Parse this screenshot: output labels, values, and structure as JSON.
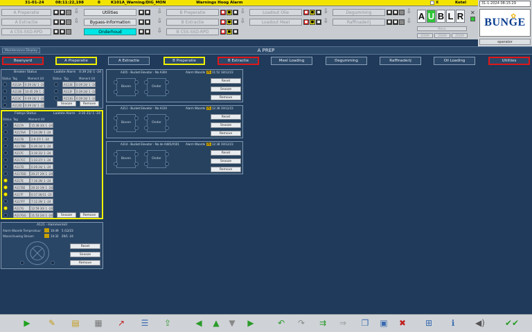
{
  "alarm_bar": {
    "date": "31-01-24",
    "time": "08:11:22,198",
    "count": "0",
    "tag": "K101A_Warning/DIG_MON",
    "message": "Warnings Hoog Alarm",
    "ack_mark": "X",
    "area": "Ketel"
  },
  "header": {
    "left_col": [
      "A Preperatie",
      "A Extractie",
      "A CSS-SSD-RPD"
    ],
    "mid_col": [
      "Utilities",
      "Bypass-Information",
      "Onderhoud"
    ],
    "right_col": [
      "B Preperatie",
      "B Extractie",
      "B CSS-SSD-RPD"
    ],
    "loadout_col": [
      "Loadout Olie",
      "Loadout Meel"
    ],
    "far_col": [
      "Degumming",
      "Raffinaderij"
    ],
    "aublr": [
      "A",
      "U",
      "B",
      "L",
      "R"
    ],
    "mini_top": "Mimic",
    "mini_btns": [
      "ZOOM",
      "ZOOM",
      "ZOOM"
    ]
  },
  "right_panel": {
    "datetime": "31-1-2024 08:15:29",
    "brand": "BUNGE",
    "operator": "operator"
  },
  "title": {
    "display_tab": "Maintenance Display",
    "page_title": "A PREP"
  },
  "nav": {
    "tabs": [
      "Beanyard",
      "A Preperatie",
      "A Extractie",
      "B Preperatie",
      "B Extractie",
      "Meel Loading",
      "Degumming",
      "Raffinaderij",
      "Oil Loading",
      "Utilities"
    ]
  },
  "breaker": {
    "title": "Breaker Status",
    "last_alarm_label": "Laatste Alarm",
    "last_alarm": "0:39 24/ 1 -24",
    "cols": [
      "Status",
      "Tag",
      "Moment Uit"
    ],
    "left_rows": [
      {
        "tag": "A113A",
        "moment": "0:39 24/ 1 -24"
      },
      {
        "tag": "A113B",
        "moment": "10:45 29/ 1 -24"
      },
      {
        "tag": "A113C",
        "moment": "0:39 24/ 1 -24"
      },
      {
        "tag": "A113D",
        "moment": "0:39 24/ 1 -24"
      }
    ],
    "right_rows": [
      {
        "tag": "A113E",
        "moment": "0:39 24/ 1 -24"
      },
      {
        "tag": "A113F",
        "moment": "0:39 24/ 1 -24"
      },
      {
        "tag": "A113G",
        "moment": "0:39 24/ 1 -24"
      }
    ],
    "snooze": "Snooze",
    "remove": "Remove"
  },
  "flatsys": {
    "title": "Flatsys Status",
    "last_alarm_label": "Laatste Alarm",
    "last_alarm": "3:16 31/ 1 -24",
    "cols": [
      "Status",
      "Tag",
      "Moment Uit"
    ],
    "rows": [
      {
        "tag": "A117A",
        "moment": "15:38 30/ 1 -24",
        "on": false
      },
      {
        "tag": "A117AA",
        "moment": "7:24 29/ 1 -24",
        "on": false
      },
      {
        "tag": "A117B",
        "moment": "2:9 27/ 1 -24",
        "on": false
      },
      {
        "tag": "A117BB",
        "moment": "0:39 24/ 1 -24",
        "on": false
      },
      {
        "tag": "A117C",
        "moment": "3:10 31/ 1 -24",
        "on": false
      },
      {
        "tag": "A117CC",
        "moment": "1:33 27/ 1 -24",
        "on": false
      },
      {
        "tag": "A117D",
        "moment": "0:39 24/ 1 -24",
        "on": false
      },
      {
        "tag": "A117DD",
        "moment": "20:27 29/ 1 -24",
        "on": false
      },
      {
        "tag": "A117E",
        "moment": "7:16 29/ 1 -24",
        "on": true
      },
      {
        "tag": "A117EE",
        "moment": "20:10 19/ 1 -24",
        "on": true
      },
      {
        "tag": "A117F",
        "moment": "0:17 26/11 -23",
        "on": true
      },
      {
        "tag": "A117FF",
        "moment": "7:12 29/ 1 -24",
        "on": false
      },
      {
        "tag": "A117G",
        "moment": "12:59 30/ 1 -24",
        "on": true
      },
      {
        "tag": "A117GG",
        "moment": "11:53 24/ 1 -24",
        "on": false
      }
    ],
    "snooze": "Snooze",
    "remove": "Remove"
  },
  "hammermill": {
    "title": "A121 - Hammermill",
    "temp_label": "Alarm Waarde Temperatuur",
    "temp_time": "10:49",
    "temp_date": "5 /12/23",
    "water_label": "Waarschuwing Stroom",
    "water_time": "14:32",
    "water_date": "29/1 -24",
    "reset": "Reset",
    "snooze": "Snooze",
    "remove": "Remove"
  },
  "elevators": [
    {
      "title": "A305 - Bucket Elevator - Na A304",
      "alarm_label": "Alarm Waarde",
      "alarm_val": "75",
      "time": "11:52",
      "date": "18/12/23",
      "top": "Boven",
      "bottom": "Onder",
      "reset": "Reset",
      "snooze": "Snooze",
      "remove": "Remove"
    },
    {
      "title": "A311 - Bucket Elevator - Na A310",
      "alarm_label": "Alarm Waarde",
      "alarm_val": "75",
      "time": "12:38",
      "date": "19/12/23",
      "top": "Boven",
      "bottom": "Onder",
      "reset": "Reset",
      "snooze": "Snooze",
      "remove": "Remove"
    },
    {
      "title": "A314 - Bucket Elevator - Na de A485/A501",
      "alarm_label": "Alarm Waarde",
      "alarm_val": "75",
      "time": "12:38",
      "date": "19/12/23",
      "top": "Boven",
      "bottom": "Onder",
      "reset": "Reset",
      "snooze": "Snooze",
      "remove": "Remove"
    }
  ],
  "toolbar_icons": [
    "play-icon",
    "wrench-icon",
    "notes-icon",
    "document-icon",
    "trend-icon",
    "list-icon",
    "export-icon",
    "arrow-left-icon",
    "arrow-up-icon",
    "arrow-down-icon",
    "arrow-right-icon",
    "undo-icon",
    "redo-icon",
    "forward-icon",
    "next-icon",
    "copy-icon",
    "save-icon",
    "cancel-icon",
    "save-as-icon",
    "info-icon",
    "speaker-icon",
    "acknowledge-icon"
  ]
}
